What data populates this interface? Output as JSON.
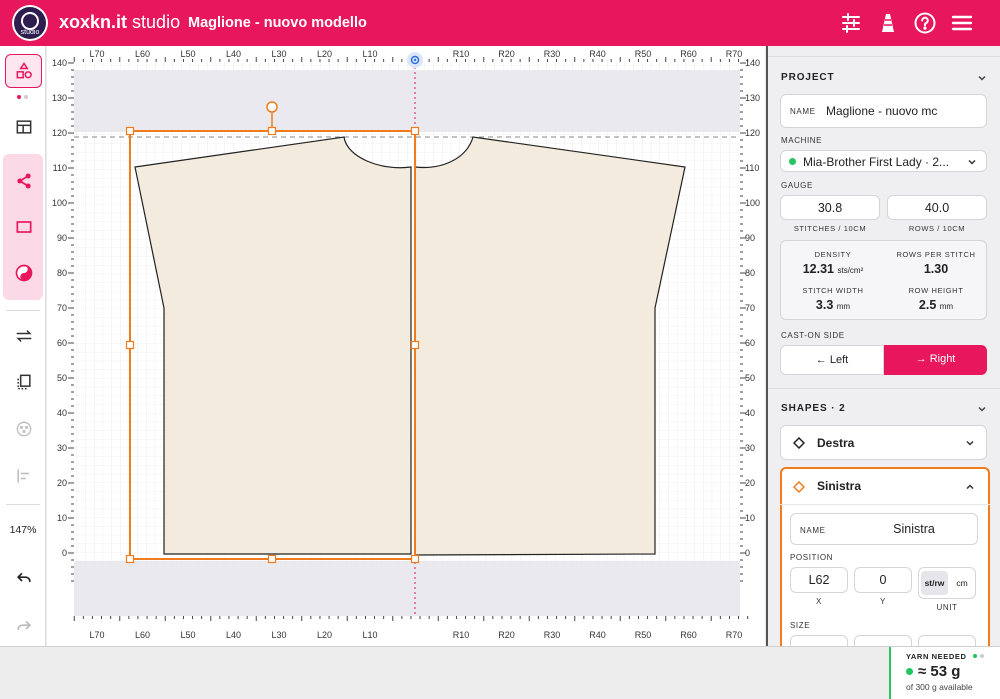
{
  "app": {
    "brand_main": "xoxkn.it",
    "brand_sub": "studio",
    "logo_text": "studio",
    "document_title": "Maglione - nuovo modello"
  },
  "header_icons": [
    "sliders-icon",
    "cone-icon",
    "help-icon",
    "menu-icon"
  ],
  "colors": {
    "brand": "#e8175d",
    "accent": "#f07c1e",
    "garment": "#f3ebdd",
    "status_green": "#22c55e"
  },
  "sidebar": {
    "zoom": "147%"
  },
  "canvas": {
    "x_ticks": [
      "L70",
      "L60",
      "L50",
      "L40",
      "L30",
      "L20",
      "L10",
      "",
      "R10",
      "R20",
      "R30",
      "R40",
      "R50",
      "R60",
      "R70"
    ],
    "y_ticks": [
      "140",
      "130",
      "120",
      "110",
      "100",
      "90",
      "80",
      "70",
      "60",
      "50",
      "40",
      "30",
      "20",
      "10",
      "0"
    ]
  },
  "project": {
    "heading": "PROJECT",
    "name_label": "NAME",
    "name_value": "Maglione - nuovo mc",
    "machine_label": "MACHINE",
    "machine_value": "Mia-Brother First Lady · 2...",
    "gauge_label": "GAUGE",
    "stitches_value": "30.8",
    "stitches_label": "STITCHES / 10CM",
    "rows_value": "40.0",
    "rows_label": "ROWS / 10CM",
    "density_label": "DENSITY",
    "density_value": "12.31",
    "density_unit": "sts/cm²",
    "rps_label": "ROWS PER STITCH",
    "rps_value": "1.30",
    "sw_label": "STITCH WIDTH",
    "sw_value": "3.3",
    "sw_unit": "mm",
    "rh_label": "ROW HEIGHT",
    "rh_value": "2.5",
    "rh_unit": "mm",
    "caston_label": "CAST-ON SIDE",
    "left_label": "Left",
    "right_label": "Right"
  },
  "shapes": {
    "heading": "SHAPES · 2",
    "items": [
      "Destra",
      "Sinistra"
    ],
    "name_label": "NAME",
    "name_value": "Sinistra",
    "position_label": "POSITION",
    "x_value": "L62",
    "y_value": "0",
    "x_label": "X",
    "y_label": "Y",
    "unit_a": "st/rw",
    "unit_b": "cm",
    "unit_label": "UNIT",
    "size_label": "SIZE"
  },
  "yarn": {
    "label": "YARN NEEDED",
    "value": "≈ 53 g",
    "sub": "of 300 g available"
  }
}
